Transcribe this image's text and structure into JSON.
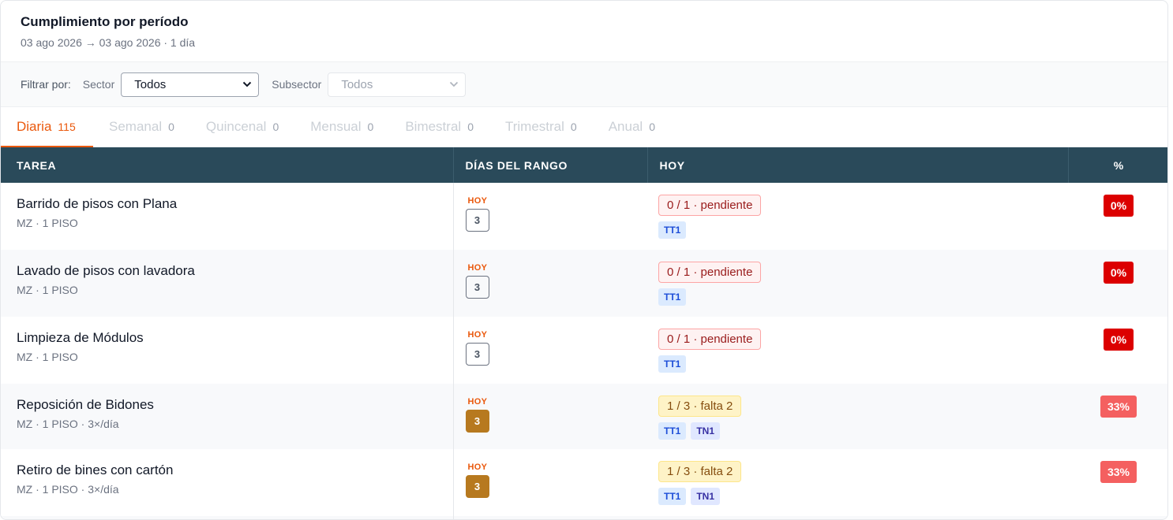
{
  "header": {
    "title": "Cumplimiento por período",
    "subtitle": "03 ago 2026 → 03 ago 2026 · 1 día"
  },
  "filters": {
    "label": "Filtrar por:",
    "sector_label": "Sector",
    "sector_value": "Todos",
    "subsector_label": "Subsector",
    "subsector_value": "Todos"
  },
  "tabs": [
    {
      "label": "Diaria",
      "count": "115"
    },
    {
      "label": "Semanal",
      "count": "0"
    },
    {
      "label": "Quincenal",
      "count": "0"
    },
    {
      "label": "Mensual",
      "count": "0"
    },
    {
      "label": "Bimestral",
      "count": "0"
    },
    {
      "label": "Trimestral",
      "count": "0"
    },
    {
      "label": "Anual",
      "count": "0"
    }
  ],
  "table": {
    "headers": [
      "TAREA",
      "DÍAS DEL RANGO",
      "HOY",
      "%"
    ],
    "rows": [
      {
        "name": "Barrido de pisos con Plana",
        "meta": "MZ · 1 PISO",
        "hoy": "HOY",
        "day": "3",
        "status": "0 / 1 · pendiente",
        "shifts": [
          "TT1"
        ],
        "pct": "0%"
      },
      {
        "name": "Lavado de pisos con lavadora",
        "meta": "MZ · 1 PISO",
        "hoy": "HOY",
        "day": "3",
        "status": "0 / 1 · pendiente",
        "shifts": [
          "TT1"
        ],
        "pct": "0%"
      },
      {
        "name": "Limpieza de Módulos",
        "meta": "MZ · 1 PISO",
        "hoy": "HOY",
        "day": "3",
        "status": "0 / 1 · pendiente",
        "shifts": [
          "TT1"
        ],
        "pct": "0%"
      },
      {
        "name": "Reposición de Bidones",
        "meta": "MZ · 1 PISO · 3×/día",
        "hoy": "HOY",
        "day": "3",
        "status": "1 / 3 · falta 2",
        "shifts": [
          "TT1",
          "TN1"
        ],
        "pct": "33%"
      },
      {
        "name": "Retiro de bines con cartón",
        "meta": "MZ · 1 PISO · 3×/día",
        "hoy": "HOY",
        "day": "3",
        "status": "1 / 3 · falta 2",
        "shifts": [
          "TT1",
          "TN1"
        ],
        "pct": "33%"
      }
    ]
  },
  "colors": {
    "accent": "#ea580c",
    "table_header": "#2a4a5a",
    "pct_zero": "#dc0000",
    "pct_partial": "#f46060",
    "day_done": "#b7791f"
  }
}
